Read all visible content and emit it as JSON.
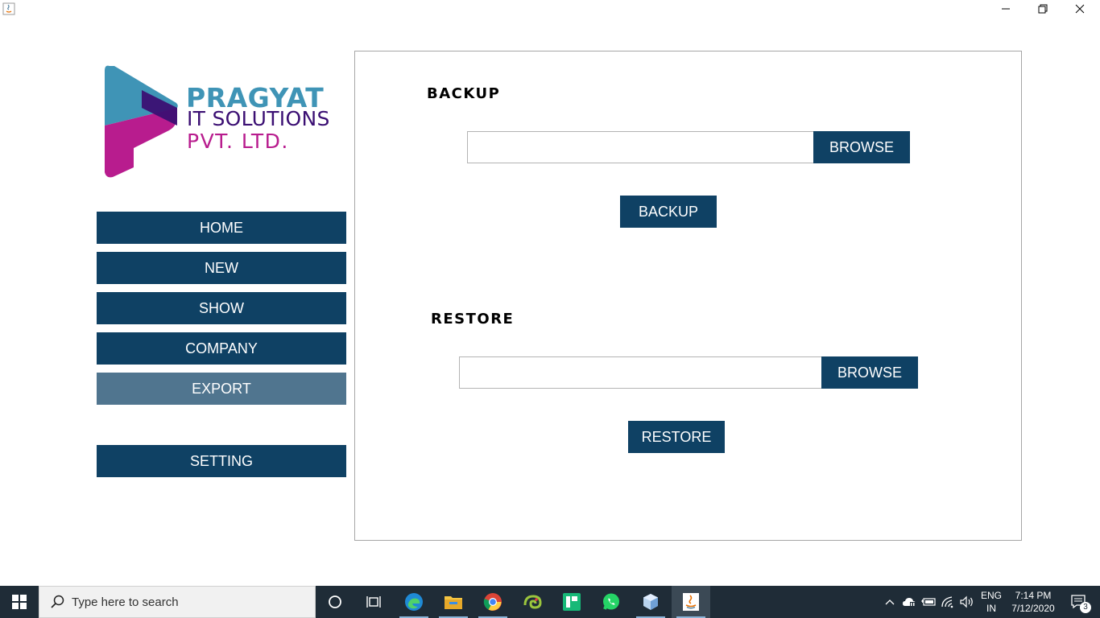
{
  "brand": {
    "line1": "PRAGYAT",
    "line2": "IT SOLUTIONS",
    "line3": "PVT. LTD."
  },
  "nav": {
    "items": [
      {
        "label": "HOME",
        "name": "nav-home",
        "active": false
      },
      {
        "label": "NEW",
        "name": "nav-new",
        "active": false
      },
      {
        "label": "SHOW",
        "name": "nav-show",
        "active": false
      },
      {
        "label": "COMPANY",
        "name": "nav-company",
        "active": false
      },
      {
        "label": "EXPORT",
        "name": "nav-export",
        "active": true
      }
    ],
    "setting_label": "SETTING"
  },
  "backup": {
    "title": "BACKUP",
    "path_value": "",
    "browse_label": "BROWSE",
    "action_label": "BACKUP"
  },
  "restore": {
    "title": "RESTORE",
    "path_value": "",
    "browse_label": "BROWSE",
    "action_label": "RESTORE"
  },
  "taskbar": {
    "search_placeholder": "Type here to search",
    "apps": [
      "cortana-icon",
      "task-view-icon",
      "edge-icon",
      "file-explorer-icon",
      "chrome-icon",
      "chameleon-app-icon",
      "green-app-icon",
      "whatsapp-icon",
      "virtualbox-icon",
      "java-icon"
    ],
    "language": "ENG",
    "region": "IN",
    "time": "7:14 PM",
    "date": "7/12/2020",
    "notification_count": "3"
  },
  "colors": {
    "button": "#0f4164",
    "button_active": "#50758f",
    "taskbar": "#1f2c37"
  }
}
